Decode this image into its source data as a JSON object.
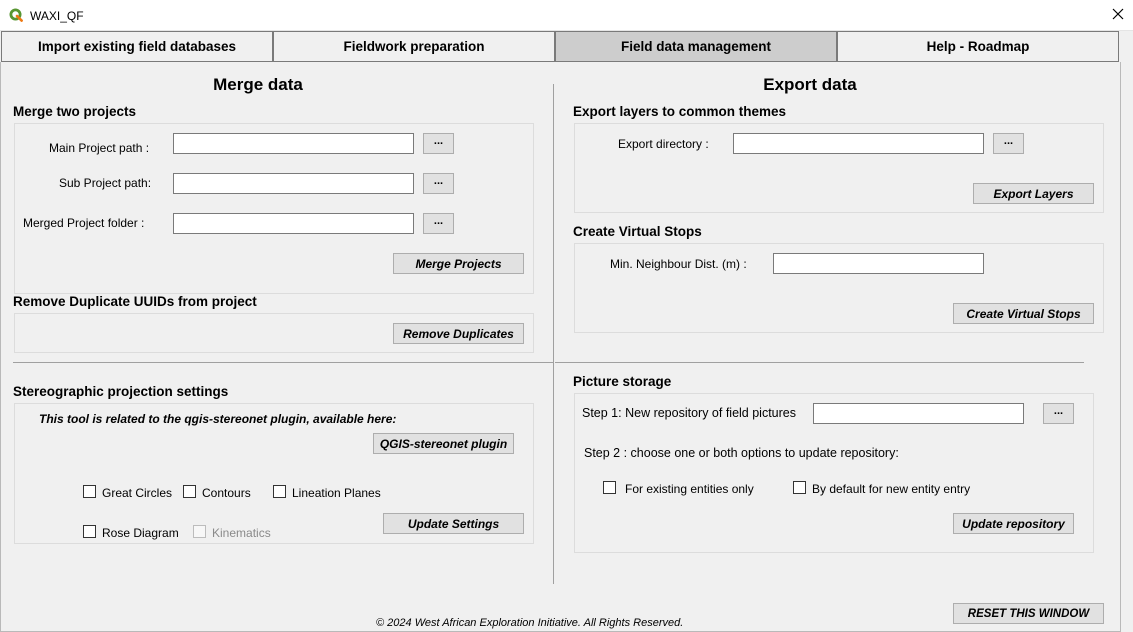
{
  "window": {
    "title": "WAXI_QF"
  },
  "tabs": [
    {
      "label": "Import existing field databases"
    },
    {
      "label": "Fieldwork preparation"
    },
    {
      "label": "Field data management",
      "active": true
    },
    {
      "label": "Help - Roadmap"
    }
  ],
  "merge": {
    "section_title": "Merge data",
    "merge_two": {
      "title": "Merge two projects",
      "main_label": "Main Project path :",
      "main_value": "",
      "sub_label": "Sub Project path:",
      "sub_value": "",
      "merged_label": "Merged Project folder :",
      "merged_value": "",
      "browse_label": "...",
      "merge_button": "Merge Projects"
    },
    "duplicates": {
      "title": "Remove Duplicate UUIDs from project",
      "button": "Remove Duplicates"
    }
  },
  "stereo": {
    "title": "Stereographic projection settings",
    "note": "This tool is related to the qgis-stereonet plugin, available here:",
    "plugin_button": "QGIS-stereonet plugin",
    "options": {
      "great_circles": "Great Circles",
      "contours": "Contours",
      "lineation_planes": "Lineation Planes",
      "rose_diagram": "Rose Diagram",
      "kinematics": "Kinematics"
    },
    "update_button": "Update Settings"
  },
  "export": {
    "section_title": "Export data",
    "themes": {
      "title": "Export layers to common themes",
      "dir_label": "Export directory :",
      "dir_value": "",
      "browse_label": "...",
      "button": "Export Layers"
    },
    "virtual": {
      "title": "Create Virtual Stops",
      "dist_label": "Min. Neighbour Dist. (m) :",
      "dist_value": "",
      "button": "Create Virtual Stops"
    }
  },
  "pictures": {
    "title": "Picture storage",
    "step1_label": "Step 1: New repository of field pictures",
    "step1_value": "",
    "browse_label": "...",
    "step2_label": "Step 2 : choose one or both options to update repository:",
    "opt_existing": "For existing entities only",
    "opt_default": "By default for new entity entry",
    "button": "Update repository"
  },
  "footer": {
    "copyright": "© 2024 West African Exploration Initiative. All Rights Reserved.",
    "reset_button": "RESET THIS WINDOW"
  },
  "colors": {
    "qgis_green": "#589632",
    "qgis_yellow": "#ee7913"
  }
}
